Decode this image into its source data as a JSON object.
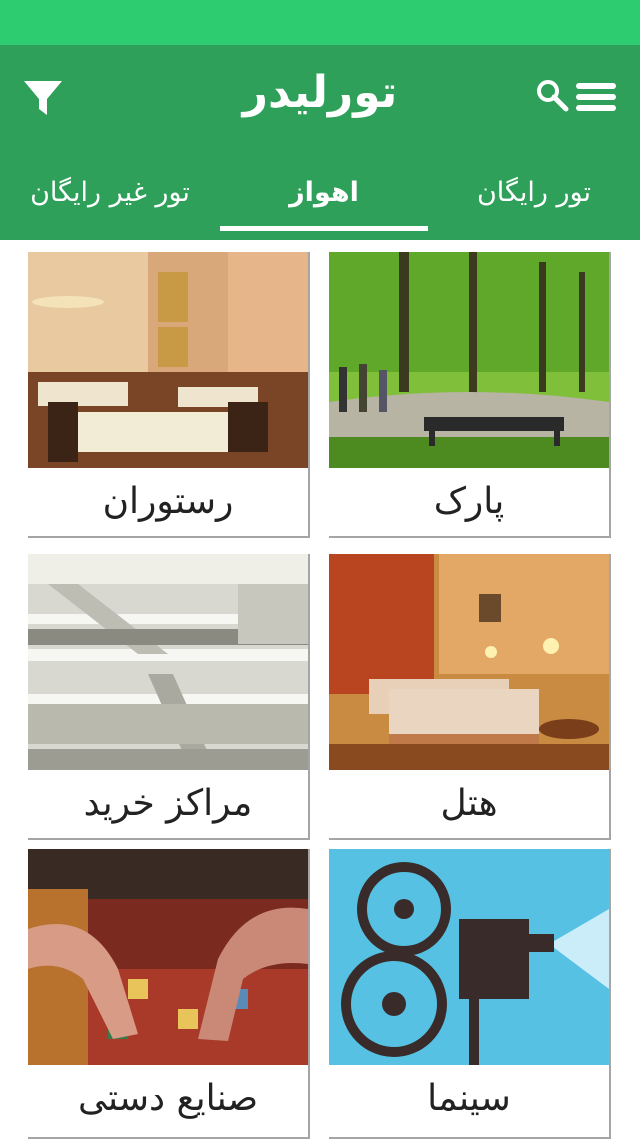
{
  "app": {
    "title": "تورلیدر"
  },
  "tabs": [
    {
      "label": "تور رایگان"
    },
    {
      "label": "اهواز"
    },
    {
      "label": "تور غیر رایگان"
    }
  ],
  "icons": {
    "menu": "menu-icon",
    "search": "search-icon",
    "filter": "filter-icon"
  },
  "colors": {
    "status_bar": "#2ecc71",
    "app_bar": "#2ea05a"
  },
  "categories": [
    {
      "label": "پارک"
    },
    {
      "label": "رستوران"
    },
    {
      "label": "هتل"
    },
    {
      "label": "مراکز خرید"
    },
    {
      "label": "سینما"
    },
    {
      "label": "صنایع دستی"
    }
  ]
}
